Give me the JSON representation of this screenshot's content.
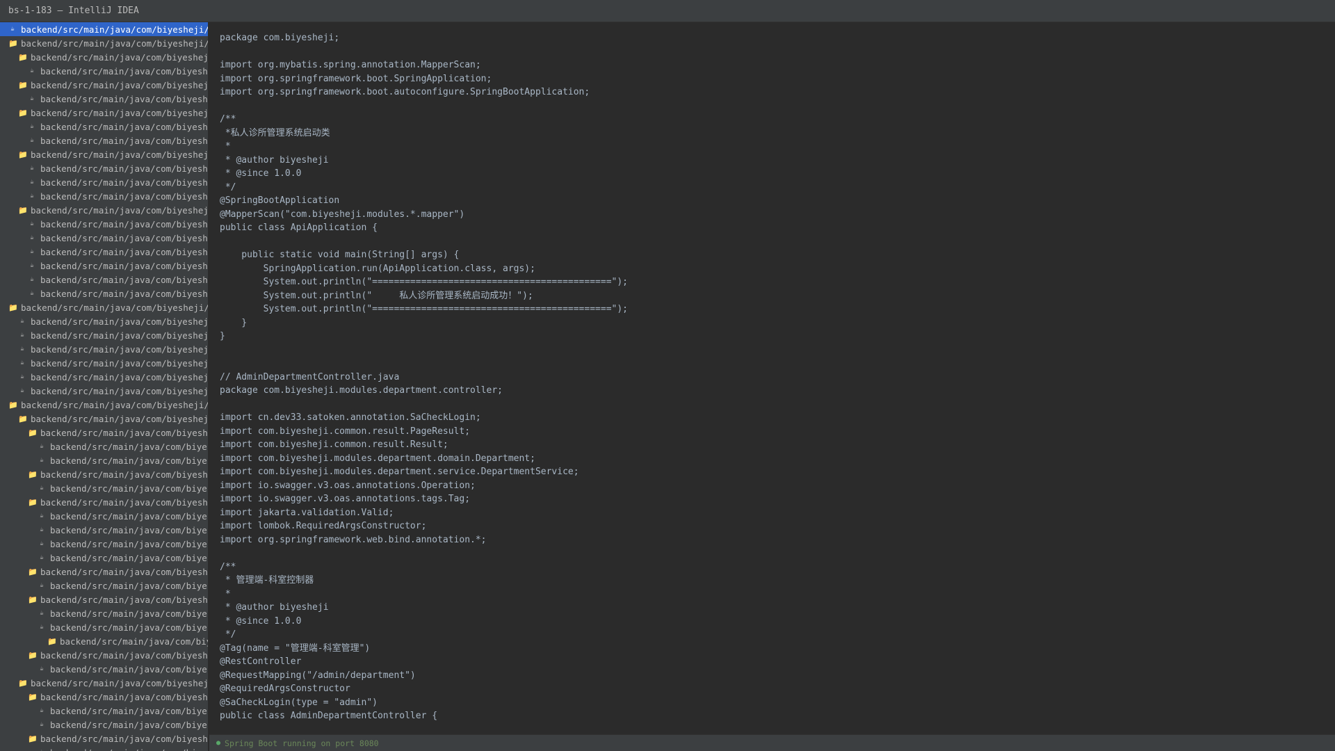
{
  "window": {
    "title": "bs-1-183 — IntelliJ IDEA"
  },
  "tree": [
    {
      "label": "backend/src/main/java/com/biyesheji/ApiApplication.java",
      "type": "file",
      "depth": 0,
      "selected": true
    },
    {
      "label": "backend/src/main/java/com/biyesheji/common",
      "type": "folder",
      "depth": 0
    },
    {
      "label": "backend/src/main/java/com/biyesheji/common/annotation",
      "type": "folder",
      "depth": 1
    },
    {
      "label": "backend/src/main/java/com/biyesheji/common/annotation/Log.java",
      "type": "file",
      "depth": 2
    },
    {
      "label": "backend/src/main/java/com/biyesheji/common/config",
      "type": "folder",
      "depth": 1
    },
    {
      "label": "backend/src/main/java/com/biyesheji/common/config/CorsConfig.java",
      "type": "file",
      "depth": 2
    },
    {
      "label": "backend/src/main/java/com/biyesheji/common/exception",
      "type": "folder",
      "depth": 1
    },
    {
      "label": "backend/src/main/java/com/biyesheji/common/exception/BusinessException.java",
      "type": "file",
      "depth": 2
    },
    {
      "label": "backend/src/main/java/com/biyesheji/common/exception/GlobalExceptionHandler.java",
      "type": "file",
      "depth": 2
    },
    {
      "label": "backend/src/main/java/com/biyesheji/common/result",
      "type": "folder",
      "depth": 1
    },
    {
      "label": "backend/src/main/java/com/biyesheji/common/result/PageResult.java",
      "type": "file",
      "depth": 2
    },
    {
      "label": "backend/src/main/java/com/biyesheji/common/result/Result.java",
      "type": "file",
      "depth": 2
    },
    {
      "label": "backend/src/main/java/com/biyesheji/common/result/ResultCode.java",
      "type": "file",
      "depth": 2
    },
    {
      "label": "backend/src/main/java/com/biyesheji/common/utils",
      "type": "folder",
      "depth": 1
    },
    {
      "label": "backend/src/main/java/com/biyesheji/common/utils/DateUtils.java",
      "type": "file",
      "depth": 2
    },
    {
      "label": "backend/src/main/java/com/biyesheji/common/utils/FileUtils.java",
      "type": "file",
      "depth": 2
    },
    {
      "label": "backend/src/main/java/com/biyesheji/common/utils/IpUtils.java",
      "type": "file",
      "depth": 2
    },
    {
      "label": "backend/src/main/java/com/biyesheji/common/utils/PasswordUtils.java",
      "type": "file",
      "depth": 2
    },
    {
      "label": "backend/src/main/java/com/biyesheji/common/utils/StringUtils.java",
      "type": "file",
      "depth": 2
    },
    {
      "label": "backend/src/main/java/com/biyesheji/common/utils/TokenUtils.java",
      "type": "file",
      "depth": 2
    },
    {
      "label": "backend/src/main/java/com/biyesheji/config",
      "type": "folder",
      "depth": 0
    },
    {
      "label": "backend/src/main/java/com/biyesheji/config/MybatisPlusConfig.java",
      "type": "file",
      "depth": 1
    },
    {
      "label": "backend/src/main/java/com/biyesheji/config/RedisConfig.java",
      "type": "file",
      "depth": 1
    },
    {
      "label": "backend/src/main/java/com/biyesheji/config/SaTokenConfig.java",
      "type": "file",
      "depth": 1
    },
    {
      "label": "backend/src/main/java/com/biyesheji/config/SwaggerConfig.java",
      "type": "file",
      "depth": 1
    },
    {
      "label": "backend/src/main/java/com/biyesheji/config/WebMvcConfig.java",
      "type": "file",
      "depth": 1
    },
    {
      "label": "backend/src/main/java/com/biyesheji/config/JacksonConfig.java",
      "type": "file",
      "depth": 1
    },
    {
      "label": "backend/src/main/java/com/biyesheji/modules",
      "type": "folder",
      "depth": 0
    },
    {
      "label": "backend/src/main/java/com/biyesheji/modules/appointment",
      "type": "folder",
      "depth": 1
    },
    {
      "label": "backend/src/main/java/com/biyesheji/modules/appointment/controller",
      "type": "folder",
      "depth": 2
    },
    {
      "label": "backend/src/main/java/com/biyesheji/modules/appointment/controller/A.java",
      "type": "file",
      "depth": 3
    },
    {
      "label": "backend/src/main/java/com/biyesheji/modules/appointment/controller/B.java",
      "type": "file",
      "depth": 3
    },
    {
      "label": "backend/src/main/java/com/biyesheji/modules/appointment/domain",
      "type": "folder",
      "depth": 2
    },
    {
      "label": "backend/src/main/java/com/biyesheji/modules/appointment/domain/A.java",
      "type": "file",
      "depth": 3
    },
    {
      "label": "backend/src/main/java/com/biyesheji/modules/appointment/dto",
      "type": "folder",
      "depth": 2
    },
    {
      "label": "backend/src/main/java/com/biyesheji/modules/appointment/dto/A.java",
      "type": "file",
      "depth": 3
    },
    {
      "label": "backend/src/main/java/com/biyesheji/modules/appointment/dto/B.java",
      "type": "file",
      "depth": 3
    },
    {
      "label": "backend/src/main/java/com/biyesheji/modules/appointment/dto/C.java",
      "type": "file",
      "depth": 3
    },
    {
      "label": "backend/src/main/java/com/biyesheji/modules/appointment/dto/D.java",
      "type": "file",
      "depth": 3
    },
    {
      "label": "backend/src/main/java/com/biyesheji/modules/appointment/mapper",
      "type": "folder",
      "depth": 2
    },
    {
      "label": "backend/src/main/java/com/biyesheji/modules/appointment/mapper/A.java",
      "type": "file",
      "depth": 3
    },
    {
      "label": "backend/src/main/java/com/biyesheji/modules/appointment/service",
      "type": "folder",
      "depth": 2
    },
    {
      "label": "backend/src/main/java/com/biyesheji/modules/appointment/service/A.java",
      "type": "file",
      "depth": 3
    },
    {
      "label": "backend/src/main/java/com/biyesheji/modules/appointment/service/B.java",
      "type": "file",
      "depth": 3
    },
    {
      "label": "backend/src/main/java/com/biyesheji/modules/appointment/service/impl",
      "type": "folder",
      "depth": 4
    },
    {
      "label": "backend/src/main/java/com/biyesheji/modules/appointment/vo",
      "type": "folder",
      "depth": 2
    },
    {
      "label": "backend/src/main/java/com/biyesheji/modules/appointment/vo/A.java",
      "type": "file",
      "depth": 3
    },
    {
      "label": "backend/src/main/java/com/biyesheji/modules/department",
      "type": "folder",
      "depth": 1
    },
    {
      "label": "backend/src/main/java/com/biyesheji/modules/department/controller",
      "type": "folder",
      "depth": 2
    },
    {
      "label": "backend/src/main/java/com/biyesheji/modules/department/controller/A.java",
      "type": "file",
      "depth": 3
    },
    {
      "label": "backend/src/main/java/com/biyesheji/modules/department/controller/B.java",
      "type": "file",
      "depth": 3
    },
    {
      "label": "backend/src/main/java/com/biyesheji/modules/department/domain",
      "type": "folder",
      "depth": 2
    },
    {
      "label": "backend/src/main/java/com/biyesheji/modules/department/domain/A.java",
      "type": "file",
      "depth": 3
    }
  ],
  "editor": {
    "lines": [
      "package com.biyesheji;",
      "",
      "import org.mybatis.spring.annotation.MapperScan;",
      "import org.springframework.boot.SpringApplication;",
      "import org.springframework.boot.autoconfigure.SpringBootApplication;",
      "",
      "/**",
      " *私人诊所管理系统启动类",
      " *",
      " * @author biyesheji",
      " * @since 1.0.0",
      " */",
      "@SpringBootApplication",
      "@MapperScan(\"com.biyesheji.modules.*.mapper\")",
      "public class ApiApplication {",
      "",
      "    public static void main(String[] args) {",
      "        SpringApplication.run(ApiApplication.class, args);",
      "        System.out.println(\"============================================\");",
      "        System.out.println(\"     私人诊所管理系统启动成功！\");",
      "        System.out.println(\"============================================\");",
      "    }",
      "}",
      "",
      "",
      "// AdminDepartmentController.java",
      "package com.biyesheji.modules.department.controller;",
      "",
      "import cn.dev33.satoken.annotation.SaCheckLogin;",
      "import com.biyesheji.common.result.PageResult;",
      "import com.biyesheji.common.result.Result;",
      "import com.biyesheji.modules.department.domain.Department;",
      "import com.biyesheji.modules.department.service.DepartmentService;",
      "import io.swagger.v3.oas.annotations.Operation;",
      "import io.swagger.v3.oas.annotations.tags.Tag;",
      "import jakarta.validation.Valid;",
      "import lombok.RequiredArgsConstructor;",
      "import org.springframework.web.bind.annotation.*;",
      "",
      "/**",
      " * 管理端-科室控制器",
      " *",
      " * @author biyesheji",
      " * @since 1.0.0",
      " */",
      "@Tag(name = \"管理端-科室管理\")",
      "@RestController",
      "@RequestMapping(\"/admin/department\")",
      "@RequiredArgsConstructor",
      "@SaCheckLogin(type = \"admin\")",
      "public class AdminDepartmentController {"
    ]
  },
  "status": {
    "text": "Spring Boot running on port 8080"
  }
}
